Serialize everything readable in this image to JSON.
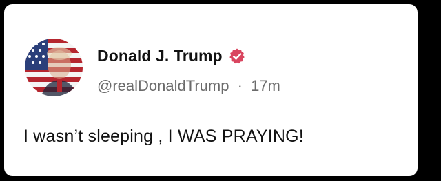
{
  "post": {
    "author": {
      "display_name": "Donald J. Trump",
      "handle": "@realDonaldTrump",
      "separator": "·",
      "time_ago": "17m",
      "avatar_icon": "avatar-flag-portrait-icon",
      "verified_icon": "verified-badge-icon"
    },
    "text": "I wasn’t sleeping , I WAS PRAYING!"
  },
  "colors": {
    "background": "#000000",
    "card": "#ffffff",
    "name": "#111111",
    "handle": "#6b6b6b",
    "verified_badge": "#d9455f",
    "flag_red": "#b5262f",
    "flag_blue": "#2b3f7a"
  }
}
